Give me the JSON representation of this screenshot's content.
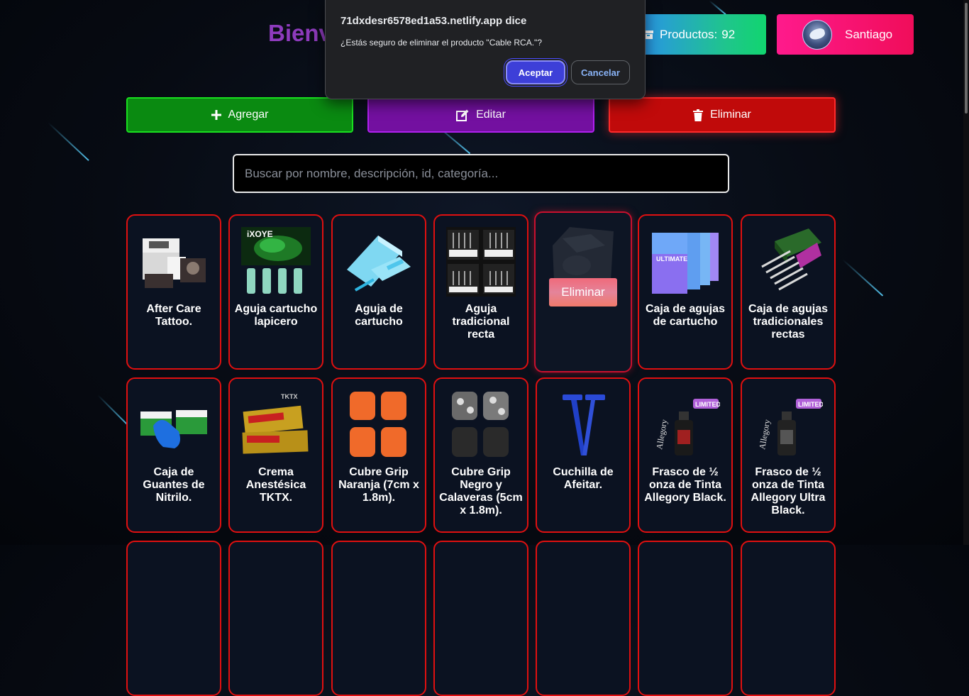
{
  "header": {
    "title": "Bienv",
    "products_label": "Productos:",
    "products_count": "92",
    "user_name": "Santiago"
  },
  "actions": {
    "add": "Agregar",
    "edit": "Editar",
    "delete": "Eliminar"
  },
  "search": {
    "placeholder": "Buscar por nombre, descripción, id, categoría..."
  },
  "dialog": {
    "title": "71dxdesr6578ed1a53.netlify.app dice",
    "message": "¿Estás seguro de eliminar el producto \"Cable RCA.\"?",
    "ok": "Aceptar",
    "cancel": "Cancelar"
  },
  "products": [
    {
      "name": "After Care Tattoo."
    },
    {
      "name": "Aguja cartucho lapicero"
    },
    {
      "name": "Aguja de cartucho"
    },
    {
      "name": "Aguja tradicional recta"
    },
    {
      "name": "",
      "overlay": "Eliminar"
    },
    {
      "name": "Caja de agujas de cartucho"
    },
    {
      "name": "Caja de agujas tradicionales rectas"
    },
    {
      "name": "Caja de Guantes de Nitrilo."
    },
    {
      "name": "Crema Anestésica TKTX."
    },
    {
      "name": "Cubre Grip Naranja (7cm x 1.8m)."
    },
    {
      "name": "Cubre Grip Negro y Calaveras (5cm x 1.8m)."
    },
    {
      "name": "Cuchilla de Afeitar."
    },
    {
      "name": "Frasco de ½ onza de Tinta Allegory Black."
    },
    {
      "name": "Frasco de ½ onza de Tinta Allegory Ultra Black."
    }
  ],
  "colors": {
    "card_border": "#e01010",
    "add_green": "#19e01f",
    "edit_purple": "#b120f0",
    "delete_red": "#ff2a2a",
    "title_purple": "#8e3bbd"
  }
}
